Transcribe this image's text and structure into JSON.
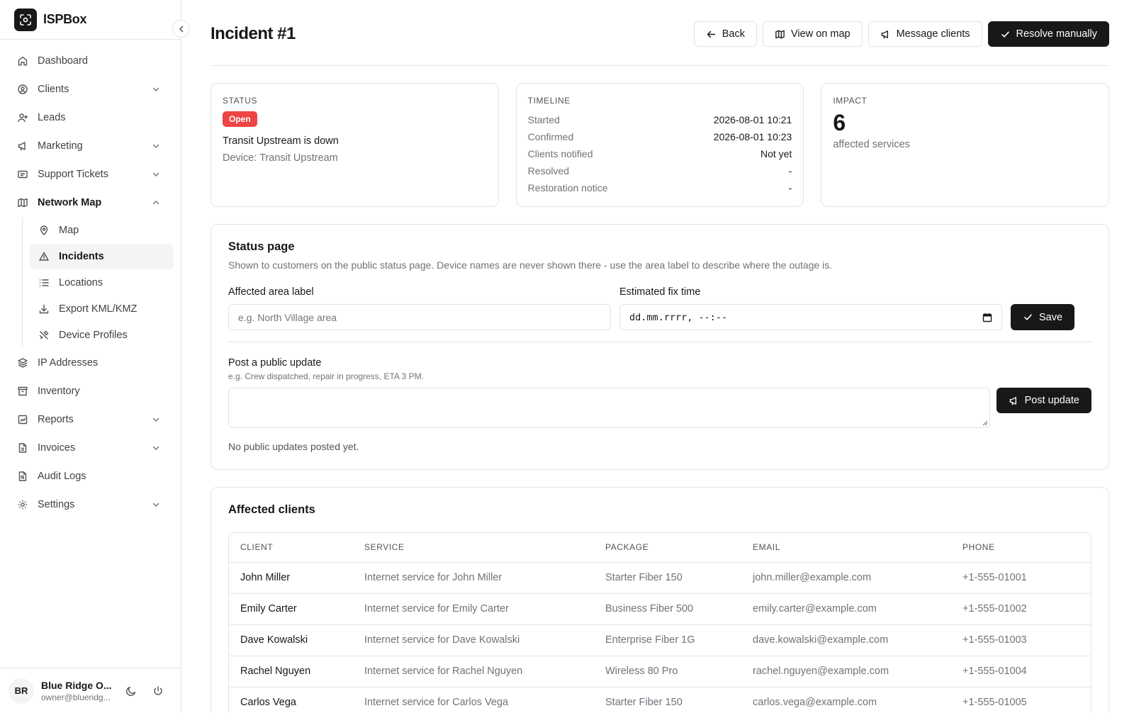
{
  "app": {
    "name": "ISPBox"
  },
  "sidebar": {
    "items": [
      {
        "label": "Dashboard",
        "icon": "home-icon"
      },
      {
        "label": "Clients",
        "icon": "user-circle-icon"
      },
      {
        "label": "Leads",
        "icon": "user-plus-icon"
      },
      {
        "label": "Marketing",
        "icon": "megaphone-icon"
      },
      {
        "label": "Support Tickets",
        "icon": "ticket-icon"
      },
      {
        "label": "Network Map",
        "icon": "map-icon"
      },
      {
        "label": "IP Addresses",
        "icon": "layers-icon"
      },
      {
        "label": "Inventory",
        "icon": "archive-icon"
      },
      {
        "label": "Reports",
        "icon": "chart-icon"
      },
      {
        "label": "Invoices",
        "icon": "file-icon"
      },
      {
        "label": "Audit Logs",
        "icon": "file-search-icon"
      },
      {
        "label": "Settings",
        "icon": "gear-icon"
      }
    ],
    "subitems": [
      {
        "label": "Map",
        "icon": "map-pin-icon"
      },
      {
        "label": "Incidents",
        "icon": "warning-icon"
      },
      {
        "label": "Locations",
        "icon": "list-icon"
      },
      {
        "label": "Export KML/KMZ",
        "icon": "download-icon"
      },
      {
        "label": "Device Profiles",
        "icon": "tools-icon"
      }
    ],
    "user": {
      "initials": "BR",
      "name": "Blue Ridge O...",
      "email": "owner@blueridg..."
    }
  },
  "header": {
    "title": "Incident #1",
    "back_label": "Back",
    "map_label": "View on map",
    "message_label": "Message clients",
    "resolve_label": "Resolve manually"
  },
  "status_card": {
    "label": "Status",
    "badge": "Open",
    "badge_color": "#ef4444",
    "title": "Transit Upstream is down",
    "device": "Device: Transit Upstream"
  },
  "timeline": {
    "label": "Timeline",
    "rows": [
      {
        "k": "Started",
        "v": "2026-08-01 10:21"
      },
      {
        "k": "Confirmed",
        "v": "2026-08-01 10:23"
      },
      {
        "k": "Clients notified",
        "v": "Not yet"
      },
      {
        "k": "Resolved",
        "v": "-"
      },
      {
        "k": "Restoration notice",
        "v": "-"
      }
    ]
  },
  "impact": {
    "label": "Impact",
    "value": "6",
    "sub": "affected services"
  },
  "status_page": {
    "title": "Status page",
    "description": "Shown to customers on the public status page. Device names are never shown there - use the area label to describe where the outage is.",
    "area_label": "Affected area label",
    "area_placeholder": "e.g. North Village area",
    "fix_label": "Estimated fix time",
    "fix_value": "dd.mm.rrrr, --:--",
    "save_label": "Save",
    "post_label": "Post a public update",
    "post_hint": "e.g. Crew dispatched, repair in progress, ETA 3 PM.",
    "post_button": "Post update",
    "empty": "No public updates posted yet."
  },
  "affected": {
    "title": "Affected clients",
    "columns": [
      "Client",
      "Service",
      "Package",
      "Email",
      "Phone"
    ],
    "rows": [
      [
        "John Miller",
        "Internet service for John Miller",
        "Starter Fiber 150",
        "john.miller@example.com",
        "+1-555-01001"
      ],
      [
        "Emily Carter",
        "Internet service for Emily Carter",
        "Business Fiber 500",
        "emily.carter@example.com",
        "+1-555-01002"
      ],
      [
        "Dave Kowalski",
        "Internet service for Dave Kowalski",
        "Enterprise Fiber 1G",
        "dave.kowalski@example.com",
        "+1-555-01003"
      ],
      [
        "Rachel Nguyen",
        "Internet service for Rachel Nguyen",
        "Wireless 80 Pro",
        "rachel.nguyen@example.com",
        "+1-555-01004"
      ],
      [
        "Carlos Vega",
        "Internet service for Carlos Vega",
        "Starter Fiber 150",
        "carlos.vega@example.com",
        "+1-555-01005"
      ]
    ]
  }
}
